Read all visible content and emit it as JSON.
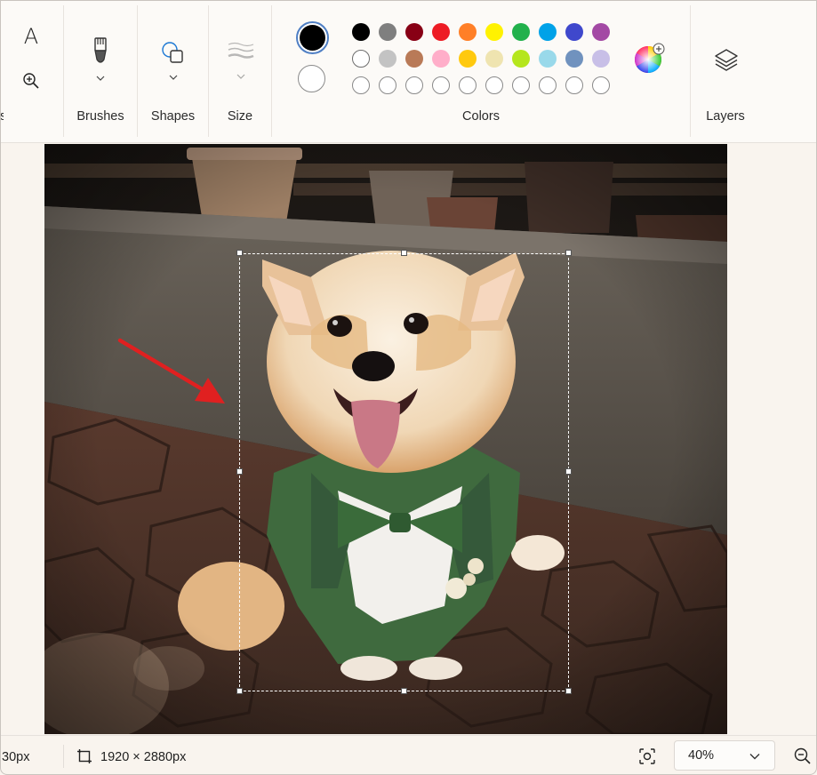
{
  "toolbar": {
    "groups": {
      "tools_label": "s",
      "brushes_label": "Brushes",
      "shapes_label": "Shapes",
      "size_label": "Size",
      "colors_label": "Colors",
      "layers_label": "Layers"
    },
    "tools": {
      "text_glyph": "A"
    },
    "colors": {
      "primary": "#000000",
      "secondary": "#ffffff",
      "palette_row1": [
        "#000000",
        "#7f7f7f",
        "#880015",
        "#ed1c24",
        "#ff7f27",
        "#fff200",
        "#22b14c",
        "#00a2e8",
        "#3f48cc",
        "#a349a4"
      ],
      "palette_row2": [
        "#ffffff",
        "#c3c3c3",
        "#b97a57",
        "#ffaec9",
        "#ffc90e",
        "#efe4b0",
        "#b5e61d",
        "#99d9ea",
        "#7092be",
        "#c8bfe7"
      ]
    }
  },
  "canvas": {
    "image_subject": "corgi-in-green-vest"
  },
  "statusbar": {
    "cursor_position": "30px",
    "image_size": "1920 × 2880px",
    "zoom": "40%"
  }
}
